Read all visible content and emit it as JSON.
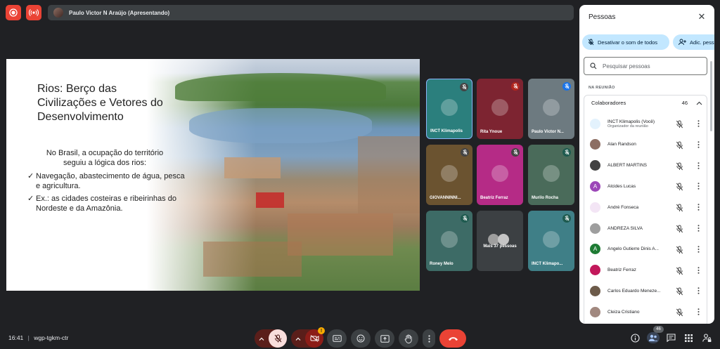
{
  "meeting": {
    "time": "16:41",
    "separator": "|",
    "code": "wgp-tgkm-ctr"
  },
  "presenter_bar": {
    "text": "Paulo Victor N Araújo (Apresentando)"
  },
  "slide": {
    "title": "Rios: Berço das Civilizações e Vetores do Desenvolvimento",
    "intro": "No Brasil, a ocupação do território seguiu a lógica dos rios:",
    "bullets": [
      "Navegação, abastecimento de água, pesca e agricultura.",
      "Ex.: as cidades costeiras e ribeirinhas do Nordeste e da Amazônia."
    ]
  },
  "tiles": [
    {
      "name": "INCT Klimapolis",
      "bg": "#2b7f7d"
    },
    {
      "name": "Rita Ynoue",
      "bg": "#7d2431"
    },
    {
      "name": "Paulo Victor N...",
      "bg": "#6d7a80"
    },
    {
      "name": "GIOVANNINNI...",
      "bg": "#6b5330"
    },
    {
      "name": "Beatriz Ferraz",
      "bg": "#b52b86"
    },
    {
      "name": "Murilo Rocha",
      "bg": "#4a6b5a"
    },
    {
      "name": "Roney Melo",
      "bg": "#3d6b66"
    },
    {
      "name": "Mais 37 pessoas",
      "bg": "#3c4043"
    },
    {
      "name": "INCT Klimapo...",
      "bg": "#3f7f87"
    }
  ],
  "panel": {
    "title": "Pessoas",
    "mute_all_label": "Desativar o som de todos",
    "add_people_label": "Adic. pess",
    "search_placeholder": "Pesquisar pessoas",
    "section_label": "NA REUNIÃO",
    "collaborators_label": "Colaboradores",
    "collaborators_count": "46",
    "people": [
      {
        "name": "INCT Klimapolis (Você)",
        "sub": "Organizador da reunião",
        "color": "#e3f2fd",
        "initial": ""
      },
      {
        "name": "Alan Randson",
        "sub": "",
        "color": "#8d6e63",
        "initial": ""
      },
      {
        "name": "ALBERT MARTINS",
        "sub": "",
        "color": "#424242",
        "initial": ""
      },
      {
        "name": "Alcides Lucas",
        "sub": "",
        "color": "#9c47b8",
        "initial": "A"
      },
      {
        "name": "André Fonseca",
        "sub": "",
        "color": "#f3e5f5",
        "initial": ""
      },
      {
        "name": "ANDREZA SILVA",
        "sub": "",
        "color": "#9e9e9e",
        "initial": ""
      },
      {
        "name": "Angelo Gutierre Dinis A...",
        "sub": "",
        "color": "#1e7b34",
        "initial": "A"
      },
      {
        "name": "Beatriz Ferraz",
        "sub": "",
        "color": "#c2185b",
        "initial": ""
      },
      {
        "name": "Carlos Eduardo Meneze...",
        "sub": "",
        "color": "#6d5b4a",
        "initial": ""
      },
      {
        "name": "Cleiza Cristiano",
        "sub": "",
        "color": "#a1887f",
        "initial": ""
      }
    ]
  },
  "toolbar": {
    "people_badge": "46",
    "warning_mark": "!"
  },
  "colors": {
    "accent_red": "#ea4335",
    "pill_blue": "#c2e7ff"
  }
}
